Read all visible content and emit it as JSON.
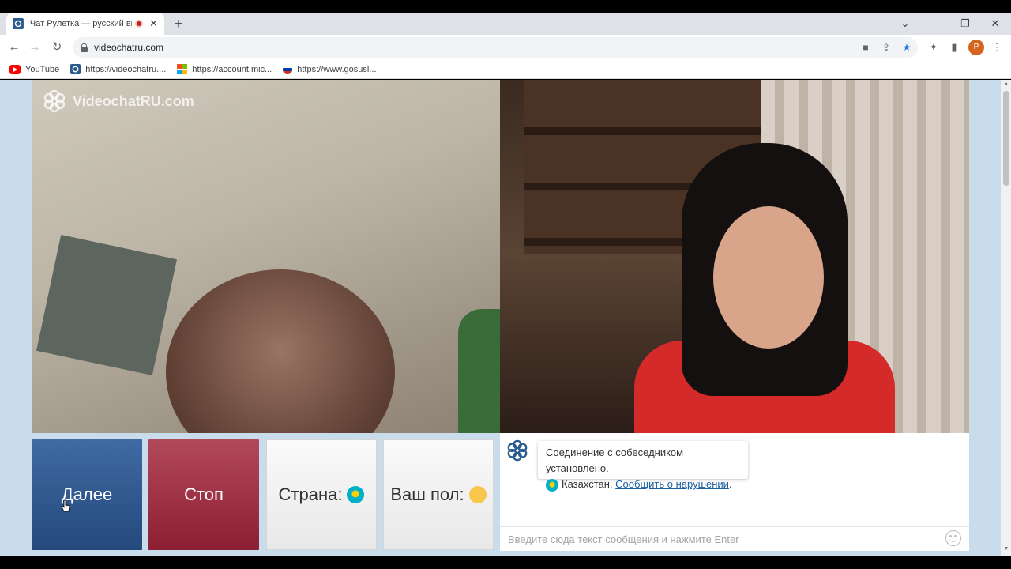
{
  "browser": {
    "tab_title": "Чат Рулетка — русский вид",
    "url": "videochatru.com",
    "profile_initial": "P",
    "bookmarks": [
      {
        "label": "YouTube",
        "icon": "youtube-icon"
      },
      {
        "label": "https://videochatru....",
        "icon": "videochatru-icon"
      },
      {
        "label": "https://account.mic...",
        "icon": "microsoft-icon"
      },
      {
        "label": "https://www.gosusl...",
        "icon": "russia-flag-icon"
      }
    ]
  },
  "site": {
    "brand": "VideochatRU.com"
  },
  "controls": {
    "next_label": "Далее",
    "stop_label": "Стоп",
    "country_label": "Страна:",
    "gender_label": "Ваш пол:"
  },
  "chat": {
    "system_message": "Соединение с собеседником установлено.",
    "country": "Казахстан.",
    "report_link": "Сообщить о нарушении",
    "report_suffix": ".",
    "input_placeholder": "Введите сюда текст сообщения и нажмите Enter"
  },
  "colors": {
    "next_button": "#2e5a92",
    "stop_button": "#a03246",
    "page_bg": "#c8dceb"
  }
}
